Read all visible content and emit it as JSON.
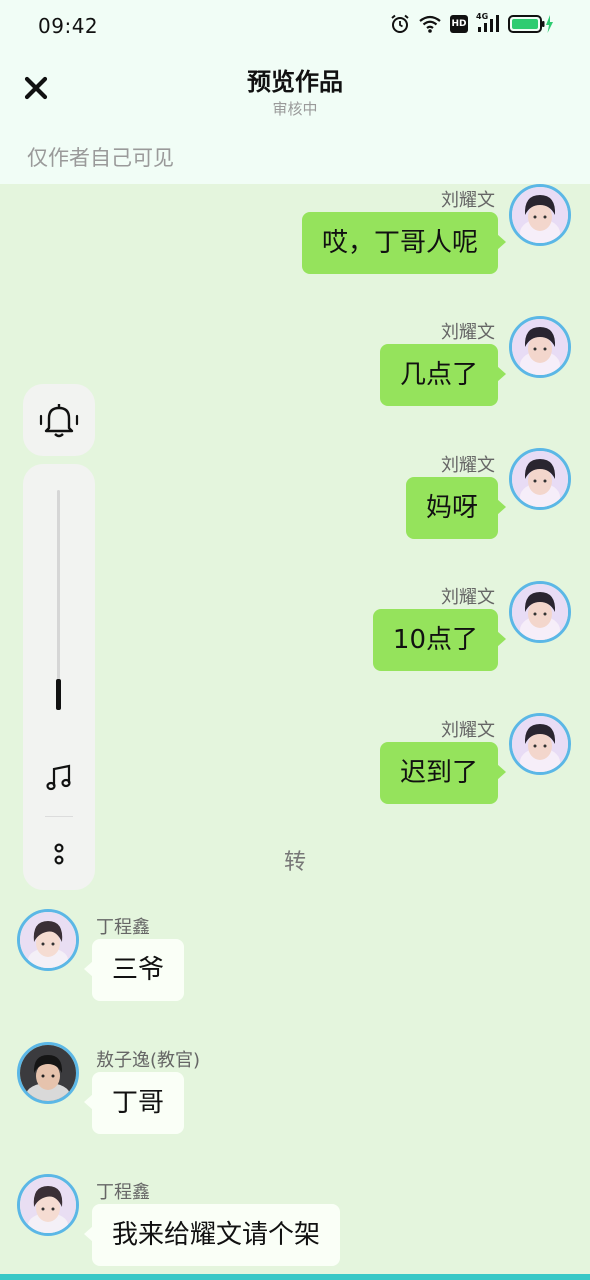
{
  "status_bar": {
    "time": "09:42",
    "icons": [
      "alarm-icon",
      "wifi-icon",
      "hd-icon",
      "signal-4g-icon",
      "battery-charging-icon"
    ],
    "hd_label": "HD",
    "network_label": "4G",
    "battery_color": "#2ecc71"
  },
  "header": {
    "title": "预览作品",
    "subtitle": "审核中",
    "close_icon": "close-icon"
  },
  "visibility_text": "仅作者自己可见",
  "volume_panel": {
    "bell_icon": "bell-vibrate-icon",
    "music_icon": "music-note-icon",
    "more_icon": "more-vertical-icon",
    "level": 0.14
  },
  "colors": {
    "chat_background": "#e4f5dd",
    "right_bubble": "#95e35c",
    "left_bubble": "#fafff7",
    "avatar_border": "#5bb7e6"
  },
  "messages": [
    {
      "side": "right",
      "sender": "刘耀文",
      "text": "哎，丁哥人呢"
    },
    {
      "side": "right",
      "sender": "刘耀文",
      "text": "几点了"
    },
    {
      "side": "right",
      "sender": "刘耀文",
      "text": "妈呀"
    },
    {
      "side": "right",
      "sender": "刘耀文",
      "text": "10点了"
    },
    {
      "side": "right",
      "sender": "刘耀文",
      "text": "迟到了"
    },
    {
      "side": "center",
      "text": "转"
    },
    {
      "side": "left",
      "sender": "丁程鑫",
      "text": "三爷"
    },
    {
      "side": "left",
      "sender": "敖子逸(教官)",
      "text": "丁哥"
    },
    {
      "side": "left",
      "sender": "丁程鑫",
      "text": "我来给耀文请个架"
    }
  ]
}
